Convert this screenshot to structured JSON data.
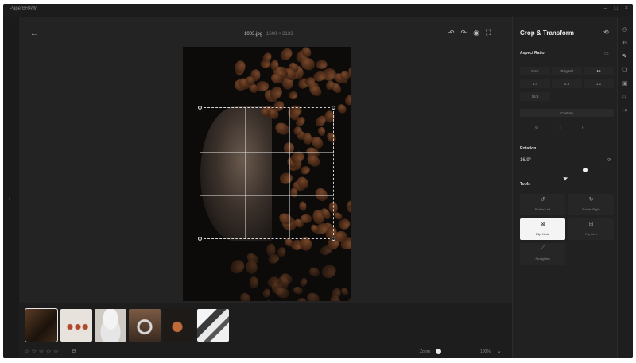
{
  "app": {
    "title": "PaperBRAW"
  },
  "window": {
    "minimize": "–",
    "maximize": "□",
    "close": "×"
  },
  "canvas": {
    "file_name": "1003.jpg",
    "file_size": "1600 × 2133"
  },
  "filmstrip": {
    "thumbnail_count": 6,
    "selected_index": 0,
    "rating_stars": 5,
    "zoom_label": "Zoom",
    "zoom_value": "100%"
  },
  "panel": {
    "title": "Crop & Transform",
    "aspect_ratio": {
      "label": "Aspect Ratio",
      "options": [
        "Free",
        "Original",
        "16",
        "3:4",
        "4:3",
        "1:1",
        "16:9"
      ],
      "custom_label": "Custom",
      "width_label": "W",
      "times": "×",
      "height_label": "H"
    },
    "rotation": {
      "label": "Rotation",
      "value": "16.9°"
    },
    "tools": {
      "label": "Tools",
      "items": [
        "Rotate Left",
        "Rotate Right",
        "Flip Horiz",
        "Flip Vert",
        "Straighten"
      ],
      "active_index": 2
    }
  }
}
